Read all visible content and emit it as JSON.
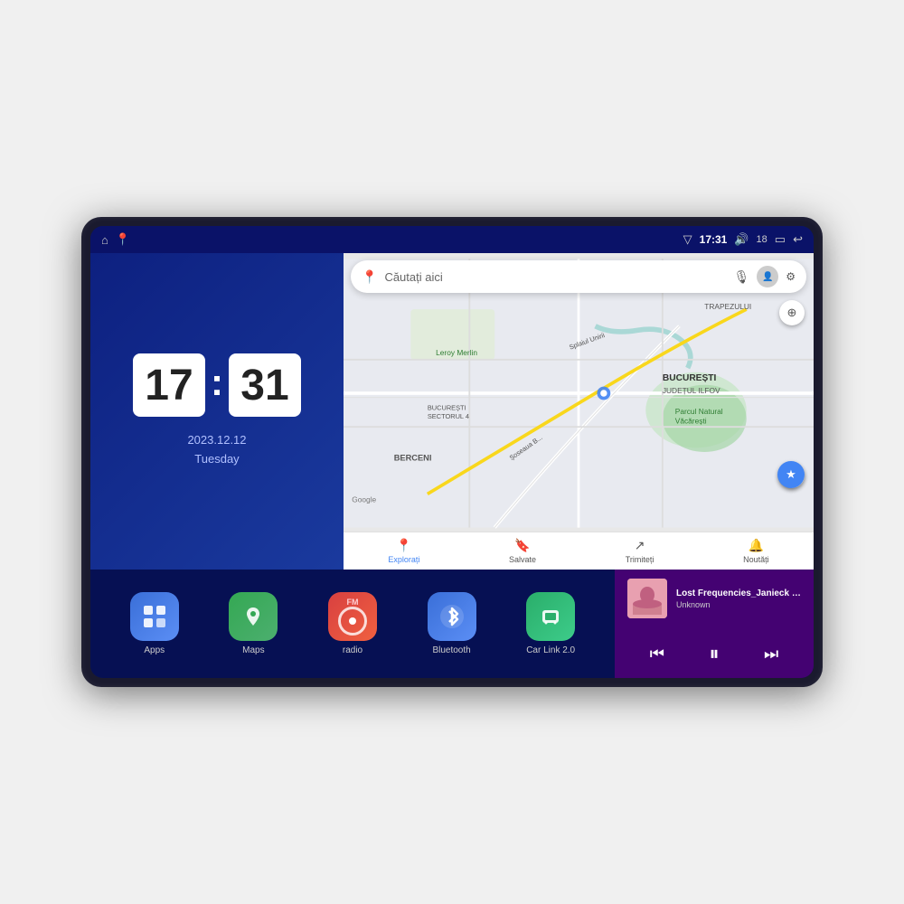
{
  "device": {
    "screen": {
      "statusBar": {
        "leftIcons": [
          "home-icon",
          "maps-icon"
        ],
        "signal": "▼",
        "time": "17:31",
        "volume": "🔊",
        "volumeLevel": "18",
        "battery": "▭",
        "back": "↩"
      },
      "clock": {
        "hours": "17",
        "minutes": "31",
        "date": "2023.12.12",
        "day": "Tuesday"
      },
      "map": {
        "searchPlaceholder": "Căutați aici",
        "googleLogo": "Google",
        "bottomNav": [
          {
            "label": "Explorați",
            "icon": "📍"
          },
          {
            "label": "Salvate",
            "icon": "🔖"
          },
          {
            "label": "Trimiteți",
            "icon": "↗"
          },
          {
            "label": "Noutăți",
            "icon": "🔔"
          }
        ],
        "locationNames": [
          "BUCUREȘTI",
          "JUDEȚUL ILFOV",
          "TRAPEZULUI",
          "Parcul Natural Văcărești",
          "Leroy Merlin",
          "BERCENI",
          "BUCUREȘTI SECTORUL 4"
        ]
      },
      "apps": [
        {
          "id": "apps",
          "label": "Apps",
          "icon": "⊞",
          "color": "#3a6fd8"
        },
        {
          "id": "maps",
          "label": "Maps",
          "icon": "📍",
          "color": "#34a853"
        },
        {
          "id": "radio",
          "label": "radio",
          "icon": "FM",
          "color": "#e84040"
        },
        {
          "id": "bluetooth",
          "label": "Bluetooth",
          "icon": "🔷",
          "color": "#3a6fd8"
        },
        {
          "id": "carlink",
          "label": "Car Link 2.0",
          "icon": "📱",
          "color": "#2aae6a"
        }
      ],
      "musicPlayer": {
        "trackTitle": "Lost Frequencies_Janieck Devy-...",
        "artist": "Unknown",
        "controls": {
          "prev": "⏮",
          "play": "⏸",
          "next": "⏭"
        }
      }
    }
  }
}
